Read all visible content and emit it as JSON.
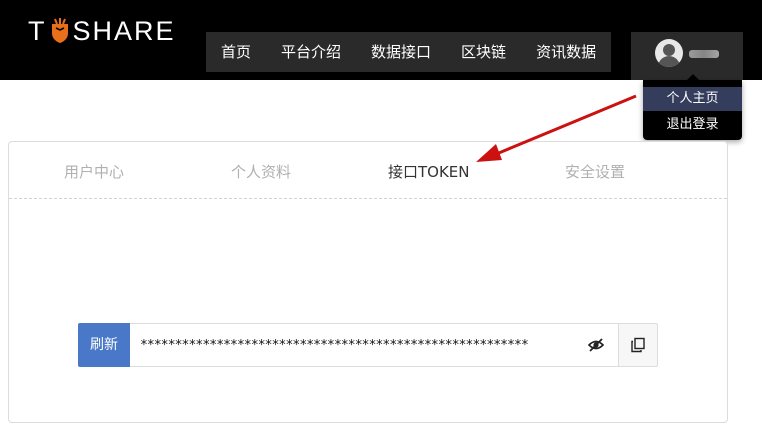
{
  "brand": {
    "name_left": "T",
    "name_right": "SHARE",
    "logo_icon": "carrot-shield-icon",
    "accent_color": "#e8701a"
  },
  "nav": {
    "items": [
      {
        "label": "首页"
      },
      {
        "label": "平台介绍"
      },
      {
        "label": "数据接口"
      },
      {
        "label": "区块链"
      },
      {
        "label": "资讯数据"
      }
    ]
  },
  "user": {
    "avatar_icon": "user-avatar-icon",
    "menu": {
      "profile_label": "个人主页",
      "logout_label": "退出登录"
    }
  },
  "tabs": [
    {
      "label": "用户中心",
      "active": false
    },
    {
      "label": "个人资料",
      "active": false
    },
    {
      "label": "接口TOKEN",
      "active": true
    },
    {
      "label": "安全设置",
      "active": false
    }
  ],
  "token": {
    "refresh_label": "刷新",
    "masked_value": "********************************************************",
    "visibility_icon": "eye-slash-icon",
    "copy_icon": "copy-icon",
    "refresh_color": "#4a78c8"
  },
  "annotation": {
    "arrow_color": "#cc1111"
  }
}
